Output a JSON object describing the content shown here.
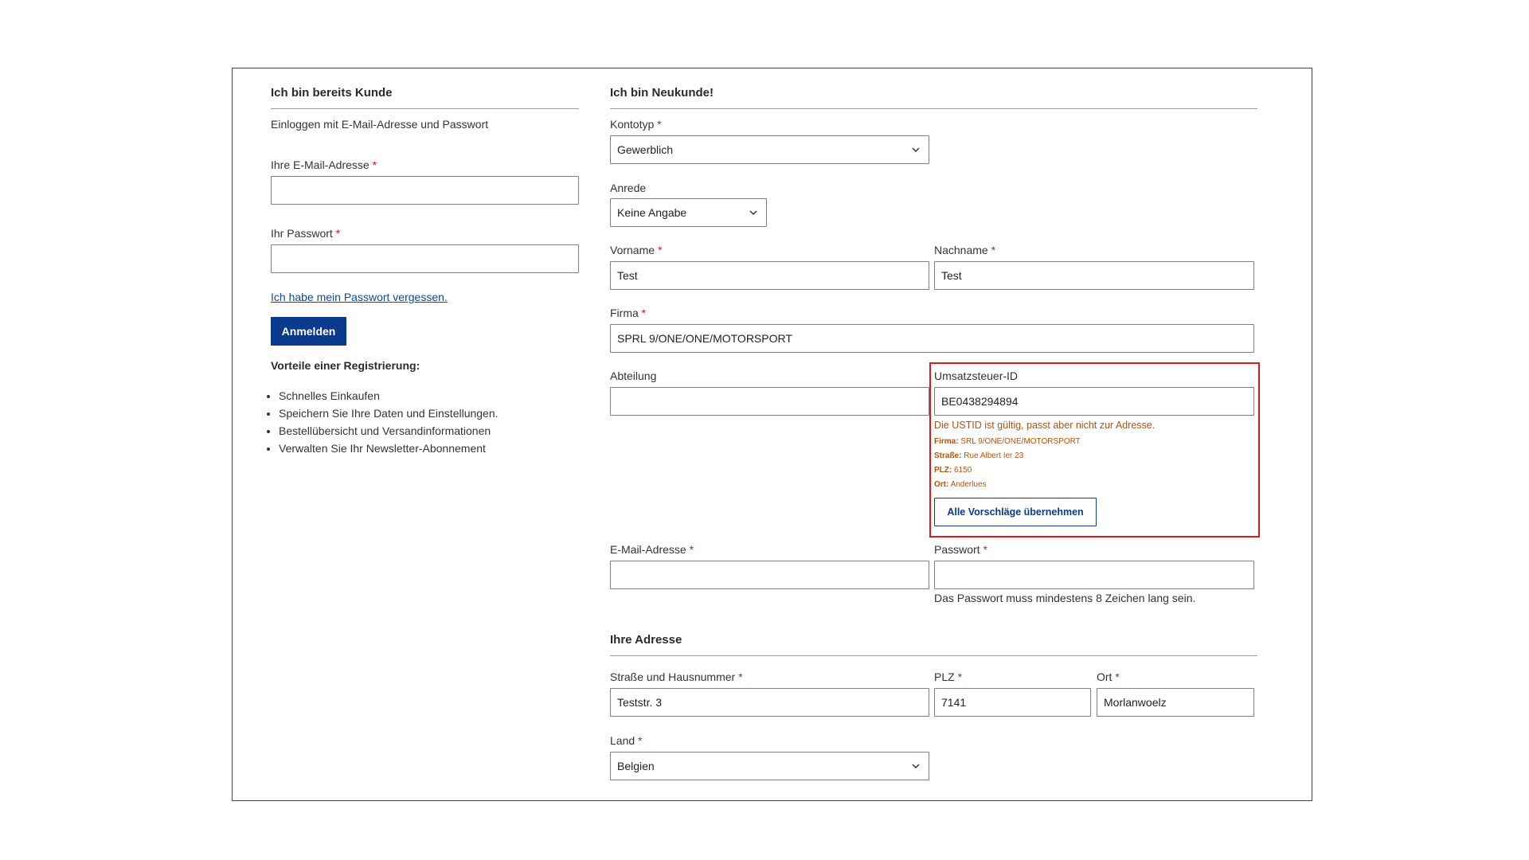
{
  "login": {
    "heading": "Ich bin bereits Kunde",
    "intro": "Einloggen mit E-Mail-Adresse und Passwort",
    "email_label": "Ihre E-Mail-Adresse",
    "email_value": "",
    "password_label": "Ihr Passwort",
    "password_value": "",
    "forgot_link": "Ich habe mein Passwort vergessen.",
    "submit_label": "Anmelden",
    "benefits_title": "Vorteile einer Registrierung:",
    "benefits": [
      "Schnelles Einkaufen",
      "Speichern Sie Ihre Daten und Einstellungen.",
      "Bestellübersicht und Versandinformationen",
      "Verwalten Sie Ihr Newsletter-Abonnement"
    ]
  },
  "register": {
    "heading": "Ich bin Neukunde!",
    "account_type_label": "Kontotyp",
    "account_type_value": "Gewerblich",
    "salutation_label": "Anrede",
    "salutation_value": "Keine Angabe",
    "firstname_label": "Vorname",
    "firstname_value": "Test",
    "lastname_label": "Nachname",
    "lastname_value": "Test",
    "company_label": "Firma",
    "company_value": "SPRL 9/ONE/ONE/MOTORSPORT",
    "department_label": "Abteilung",
    "department_value": "",
    "vat_label": "Umsatzsteuer-ID",
    "vat_value": "BE0438294894",
    "vat_warning": "Die USTID ist gültig, passt aber nicht zur Adresse.",
    "suggestions": [
      {
        "key": "Firma:",
        "value": "SRL 9/ONE/ONE/MOTORSPORT"
      },
      {
        "key": "Straße:",
        "value": "Rue Albert Ier 23"
      },
      {
        "key": "PLZ:",
        "value": "6150"
      },
      {
        "key": "Ort:",
        "value": "Anderlues"
      }
    ],
    "apply_suggestions_label": "Alle Vorschläge übernehmen",
    "email_label": "E-Mail-Adresse",
    "email_value": "",
    "password_label": "Passwort",
    "password_value": "",
    "password_hint": "Das Passwort muss mindestens 8 Zeichen lang sein.",
    "required_marker": "*"
  },
  "address": {
    "heading": "Ihre Adresse",
    "street_label": "Straße und Hausnummer",
    "street_value": "Teststr. 3",
    "zip_label": "PLZ",
    "zip_value": "7141",
    "city_label": "Ort",
    "city_value": "Morlanwoelz",
    "country_label": "Land",
    "country_value": "Belgien"
  },
  "colors": {
    "primary": "#0a3a8c",
    "required": "#c41e1e",
    "warning": "#b4520f",
    "highlight": "#e01818"
  },
  "icons": {
    "select_chevron": "chevron-down-icon"
  }
}
